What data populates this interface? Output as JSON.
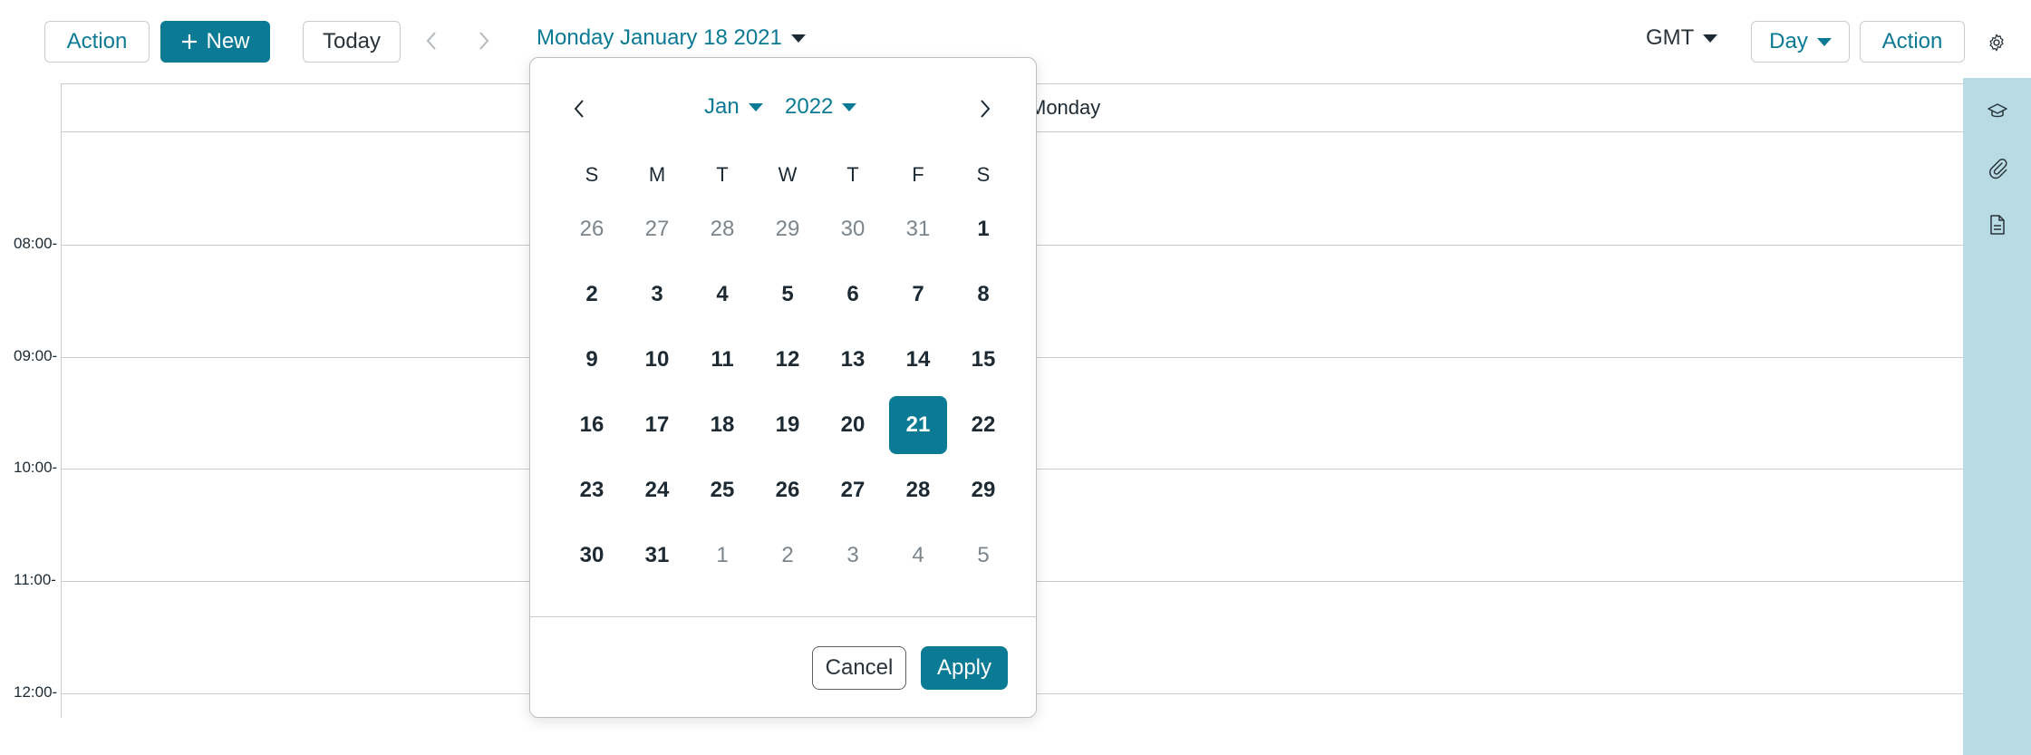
{
  "toolbar": {
    "action_left": "Action",
    "new_button": "New",
    "today": "Today",
    "date_title": "Monday January 18 2021",
    "timezone": "GMT",
    "view": "Day",
    "action_right": "Action"
  },
  "calendar": {
    "day_header": "Monday",
    "hours": [
      "08:00",
      "09:00",
      "10:00",
      "11:00",
      "12:00"
    ]
  },
  "picker": {
    "month": "Jan",
    "year": "2022",
    "weekdays": [
      "S",
      "M",
      "T",
      "W",
      "T",
      "F",
      "S"
    ],
    "weeks": [
      [
        "26",
        "27",
        "28",
        "29",
        "30",
        "31",
        "1"
      ],
      [
        "2",
        "3",
        "4",
        "5",
        "6",
        "7",
        "8"
      ],
      [
        "9",
        "10",
        "11",
        "12",
        "13",
        "14",
        "15"
      ],
      [
        "16",
        "17",
        "18",
        "19",
        "20",
        "21",
        "22"
      ],
      [
        "23",
        "24",
        "25",
        "26",
        "27",
        "28",
        "29"
      ],
      [
        "30",
        "31",
        "1",
        "2",
        "3",
        "4",
        "5"
      ]
    ],
    "selected_day": "21",
    "cancel": "Cancel",
    "apply": "Apply"
  },
  "rail": {
    "icons": [
      "graduation-cap-icon",
      "paperclip-icon",
      "document-icon"
    ]
  },
  "colors": {
    "accent": "#0b7a94",
    "rail_bg": "#b8dbe4",
    "border": "#c9ccd0"
  }
}
